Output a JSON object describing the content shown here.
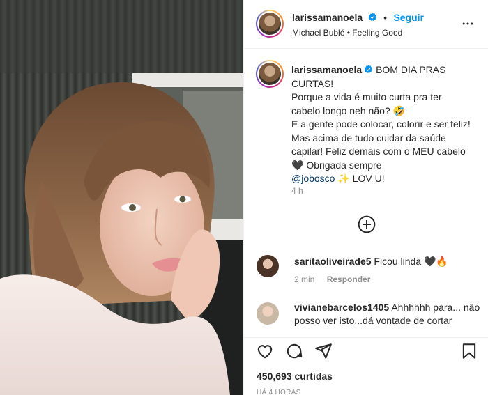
{
  "post": {
    "author": "larissamanoela",
    "follow_label": "Seguir",
    "separator": "•",
    "music": "Michael Bublé • Feeling Good",
    "more_icon": "more-horizontal-icon"
  },
  "caption": {
    "author": "larissamanoela",
    "text_1": "BOM DIA PRAS CURTAS!",
    "text_2": "Porque a vida é muito curta pra ter cabelo longo neh não? 🤣",
    "text_3": "E a gente pode colocar, colorir e ser feliz! Mas acima de tudo cuidar da saúde capilar! Feliz demais com o MEU cabelo 🖤 Obrigada sempre",
    "mention": "@jobosco",
    "text_4": "✨ LOV U!",
    "time": "4 h"
  },
  "comments": [
    {
      "username": "saritaoliveirade5",
      "text": "Ficou linda 🖤🔥",
      "time": "2 min",
      "reply_label": "Responder"
    },
    {
      "username": "vivianebarcelos1405",
      "text": "Ahhhhhh pára... não posso ver isto...dá vontade de cortar"
    }
  ],
  "actions": {
    "like_icon": "heart-icon",
    "comment_icon": "comment-icon",
    "share_icon": "send-icon",
    "save_icon": "bookmark-icon"
  },
  "likes": "450,693 curtidas",
  "posted_ago": "HÁ 4 HORAS",
  "colors": {
    "accent": "#0095f6",
    "mention": "#00376b",
    "muted": "#8e8e8e",
    "text": "#262626",
    "verified": "#0095f6"
  }
}
